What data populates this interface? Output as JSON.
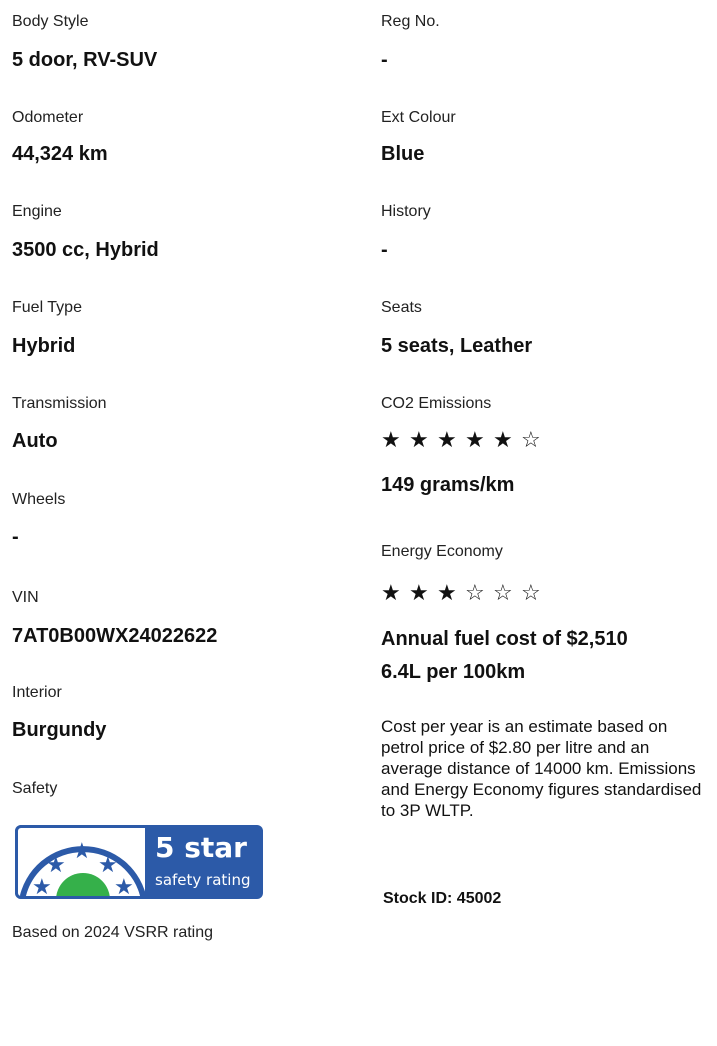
{
  "left": {
    "body_style": {
      "label": "Body Style",
      "value": "5 door, RV-SUV"
    },
    "odometer": {
      "label": "Odometer",
      "value": "44,324 km"
    },
    "engine": {
      "label": "Engine",
      "value": "3500 cc, Hybrid"
    },
    "fuel_type": {
      "label": "Fuel Type",
      "value": "Hybrid"
    },
    "transmission": {
      "label": "Transmission",
      "value": "Auto"
    },
    "wheels": {
      "label": "Wheels",
      "value": "-"
    },
    "vin": {
      "label": "VIN",
      "value": "7AT0B00WX24022622"
    },
    "interior": {
      "label": "Interior",
      "value": "Burgundy"
    },
    "safety": {
      "label": "Safety",
      "badge_title": "5 star",
      "badge_subtitle": "safety rating",
      "note": "Based on 2024 VSRR rating"
    }
  },
  "right": {
    "reg_no": {
      "label": "Reg No.",
      "value": "-"
    },
    "ext_colour": {
      "label": "Ext Colour",
      "value": "Blue"
    },
    "history": {
      "label": "History",
      "value": "-"
    },
    "seats": {
      "label": "Seats",
      "value": "5 seats, Leather"
    },
    "co2": {
      "label": "CO2 Emissions",
      "stars_filled": 5,
      "stars_total": 6,
      "value": "149 grams/km"
    },
    "energy": {
      "label": "Energy Economy",
      "stars_filled": 3,
      "stars_total": 6,
      "annual_cost": "Annual fuel cost of $2,510",
      "consumption": "6.4L per 100km"
    },
    "cost_note": "Cost per year is an estimate based on petrol price of  $2.80 per litre and an average distance of 14000 km. Emissions and Energy Economy figures standardised to 3P WLTP.",
    "stock_id": "Stock ID: 45002"
  },
  "colors": {
    "badge_blue": "#2c5aa8",
    "badge_green": "#35b04a"
  },
  "icons": {
    "star_filled": "★",
    "star_empty": "☆"
  }
}
